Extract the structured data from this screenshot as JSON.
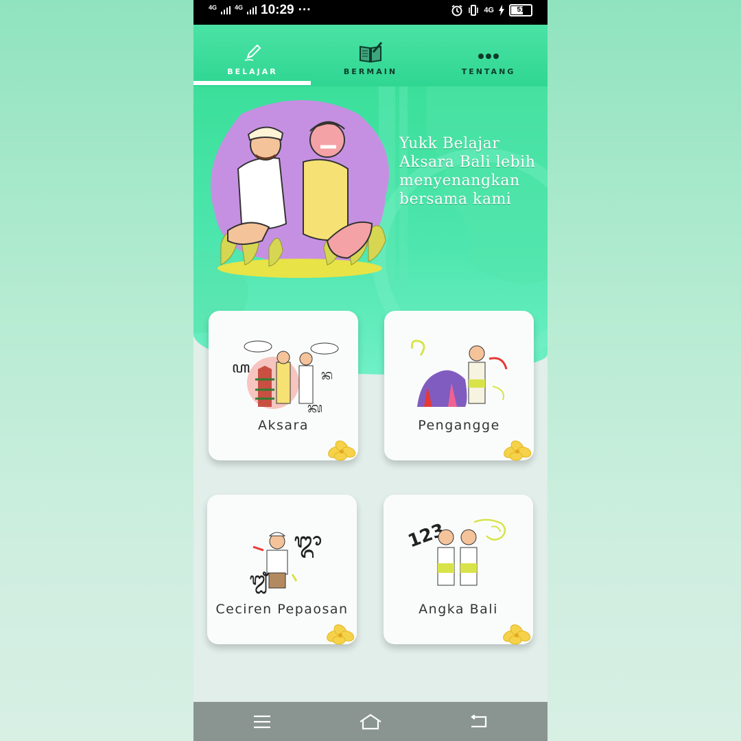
{
  "status_bar": {
    "network1": "4G",
    "network2": "4G",
    "time": "10:29",
    "dots": "···",
    "network_right": "4G",
    "battery": "51"
  },
  "tabs": [
    {
      "label": "BELAJAR",
      "icon": "pencil-icon",
      "active": true
    },
    {
      "label": "BERMAIN",
      "icon": "book-pencil-icon",
      "active": false
    },
    {
      "label": "TENTANG",
      "icon": "more-dots-icon",
      "active": false
    }
  ],
  "hero": {
    "lines": [
      "Yukk Belajar",
      "Aksara Bali lebih",
      "menyenangkan",
      "bersama kami"
    ]
  },
  "cards": [
    {
      "title": "Aksara"
    },
    {
      "title": "Pengangge"
    },
    {
      "title": "Ceciren Pepaosan"
    },
    {
      "title": "Angka Bali"
    }
  ],
  "navbar": {
    "icons": [
      "menu-icon",
      "home-icon",
      "back-icon"
    ]
  },
  "colors": {
    "accent": "#3bdf9a",
    "tab_text": "#0d3b2a",
    "active_tab_text": "#ffffff"
  }
}
